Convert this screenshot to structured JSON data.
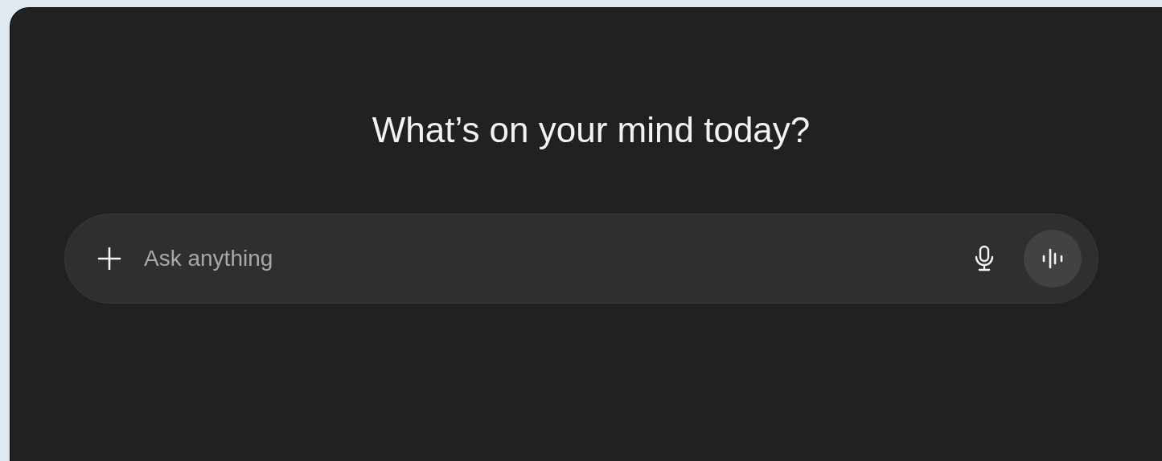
{
  "heading": "What’s on your mind today?",
  "composer": {
    "placeholder": "Ask anything"
  }
}
